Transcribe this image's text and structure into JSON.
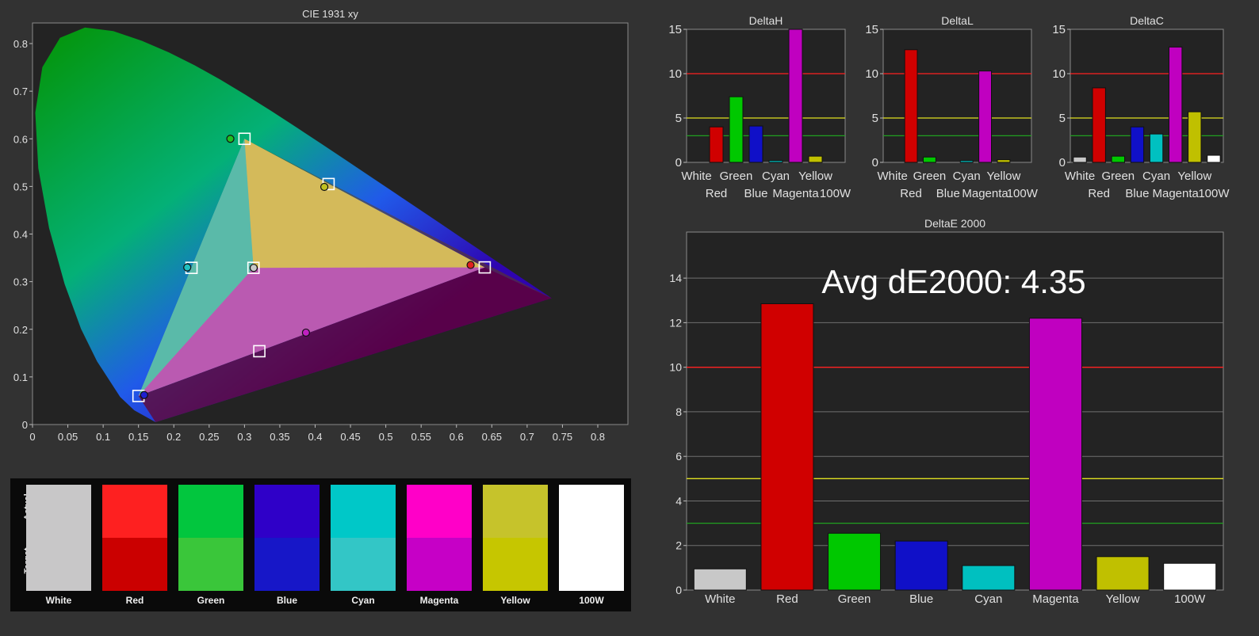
{
  "cie": {
    "title": "CIE 1931 xy",
    "x_ticks": [
      "0",
      "0.05",
      "0.1",
      "0.15",
      "0.2",
      "0.25",
      "0.3",
      "0.35",
      "0.4",
      "0.45",
      "0.5",
      "0.55",
      "0.6",
      "0.65",
      "0.7",
      "0.75",
      "0.8"
    ],
    "y_ticks": [
      "0",
      "0.1",
      "0.2",
      "0.3",
      "0.4",
      "0.5",
      "0.6",
      "0.7",
      "0.8"
    ],
    "targets": [
      {
        "name": "red",
        "x": 0.64,
        "y": 0.33
      },
      {
        "name": "green",
        "x": 0.3,
        "y": 0.6
      },
      {
        "name": "blue",
        "x": 0.15,
        "y": 0.06
      },
      {
        "name": "white",
        "x": 0.3127,
        "y": 0.329
      },
      {
        "name": "cyan",
        "x": 0.225,
        "y": 0.329
      },
      {
        "name": "magenta",
        "x": 0.321,
        "y": 0.154
      },
      {
        "name": "yellow",
        "x": 0.419,
        "y": 0.505
      }
    ],
    "actuals": [
      {
        "name": "red",
        "x": 0.62,
        "y": 0.335,
        "color": "#e02020"
      },
      {
        "name": "green",
        "x": 0.28,
        "y": 0.6,
        "color": "#20c020"
      },
      {
        "name": "blue",
        "x": 0.158,
        "y": 0.062,
        "color": "#2020d0"
      },
      {
        "name": "white",
        "x": 0.313,
        "y": 0.329,
        "color": "#c8c8c8"
      },
      {
        "name": "cyan",
        "x": 0.219,
        "y": 0.33,
        "color": "#20c0c0"
      },
      {
        "name": "magenta",
        "x": 0.387,
        "y": 0.193,
        "color": "#c020c0"
      },
      {
        "name": "yellow",
        "x": 0.413,
        "y": 0.499,
        "color": "#c0c020"
      }
    ]
  },
  "swatches": {
    "actual_label": "Actual",
    "target_label": "Target",
    "items": [
      {
        "label": "White",
        "actual": "#c8c7c8",
        "target": "#c8c7c8"
      },
      {
        "label": "Red",
        "actual": "#fe2020",
        "target": "#cb0000"
      },
      {
        "label": "Green",
        "actual": "#02c63e",
        "target": "#3ac63a"
      },
      {
        "label": "Blue",
        "actual": "#2f00c8",
        "target": "#1717c8"
      },
      {
        "label": "Cyan",
        "actual": "#00c8c8",
        "target": "#33c6c6"
      },
      {
        "label": "Magenta",
        "actual": "#ff00c8",
        "target": "#c600c6"
      },
      {
        "label": "Yellow",
        "actual": "#c6c32b",
        "target": "#c6c600"
      },
      {
        "label": "100W",
        "actual": "#ffffff",
        "target": "#ffffff"
      }
    ]
  },
  "chart_data": [
    {
      "type": "bar",
      "title": "DeltaH",
      "categories": [
        "White",
        "Red",
        "Green",
        "Blue",
        "Cyan",
        "Magenta",
        "Yellow",
        "100W"
      ],
      "values": [
        0,
        4.0,
        7.4,
        4.1,
        0.2,
        15,
        0.7,
        0
      ],
      "ylim": [
        0,
        15
      ],
      "y_ticks": [
        "0",
        "5",
        "10",
        "15"
      ],
      "thresholds": [
        {
          "value": 10,
          "color": "#ff2020"
        },
        {
          "value": 5,
          "color": "#e0e020"
        },
        {
          "value": 3,
          "color": "#20a020"
        }
      ]
    },
    {
      "type": "bar",
      "title": "DeltaL",
      "categories": [
        "White",
        "Red",
        "Green",
        "Blue",
        "Cyan",
        "Magenta",
        "Yellow",
        "100W"
      ],
      "values": [
        0,
        12.7,
        0.6,
        0,
        0.2,
        10.3,
        0.3,
        0
      ],
      "ylim": [
        0,
        15
      ],
      "y_ticks": [
        "0",
        "5",
        "10",
        "15"
      ],
      "thresholds": [
        {
          "value": 10,
          "color": "#ff2020"
        },
        {
          "value": 5,
          "color": "#e0e020"
        },
        {
          "value": 3,
          "color": "#20a020"
        }
      ]
    },
    {
      "type": "bar",
      "title": "DeltaC",
      "categories": [
        "White",
        "Red",
        "Green",
        "Blue",
        "Cyan",
        "Magenta",
        "Yellow",
        "100W"
      ],
      "values": [
        0.6,
        8.4,
        0.7,
        4.0,
        3.2,
        13.0,
        5.7,
        0.8
      ],
      "ylim": [
        0,
        15
      ],
      "y_ticks": [
        "0",
        "5",
        "10",
        "15"
      ],
      "thresholds": [
        {
          "value": 10,
          "color": "#ff2020"
        },
        {
          "value": 5,
          "color": "#e0e020"
        },
        {
          "value": 3,
          "color": "#20a020"
        }
      ]
    },
    {
      "type": "bar",
      "title": "DeltaE 2000",
      "annotation": "Avg dE2000: 4.35",
      "categories": [
        "White",
        "Red",
        "Green",
        "Blue",
        "Cyan",
        "Magenta",
        "Yellow",
        "100W"
      ],
      "values": [
        0.95,
        12.85,
        2.55,
        2.2,
        1.1,
        12.2,
        1.5,
        1.2
      ],
      "ylim": [
        0,
        15
      ],
      "y_ticks": [
        "0",
        "2",
        "4",
        "6",
        "8",
        "10",
        "12",
        "14"
      ],
      "thresholds": [
        {
          "value": 10,
          "color": "#ff2020"
        },
        {
          "value": 5,
          "color": "#e0e020"
        },
        {
          "value": 3,
          "color": "#20a020"
        }
      ]
    }
  ],
  "bar_colors": [
    "#c8c8c8",
    "#d00000",
    "#00c800",
    "#1010c8",
    "#00c0c0",
    "#c000c0",
    "#c0c000",
    "#ffffff"
  ]
}
